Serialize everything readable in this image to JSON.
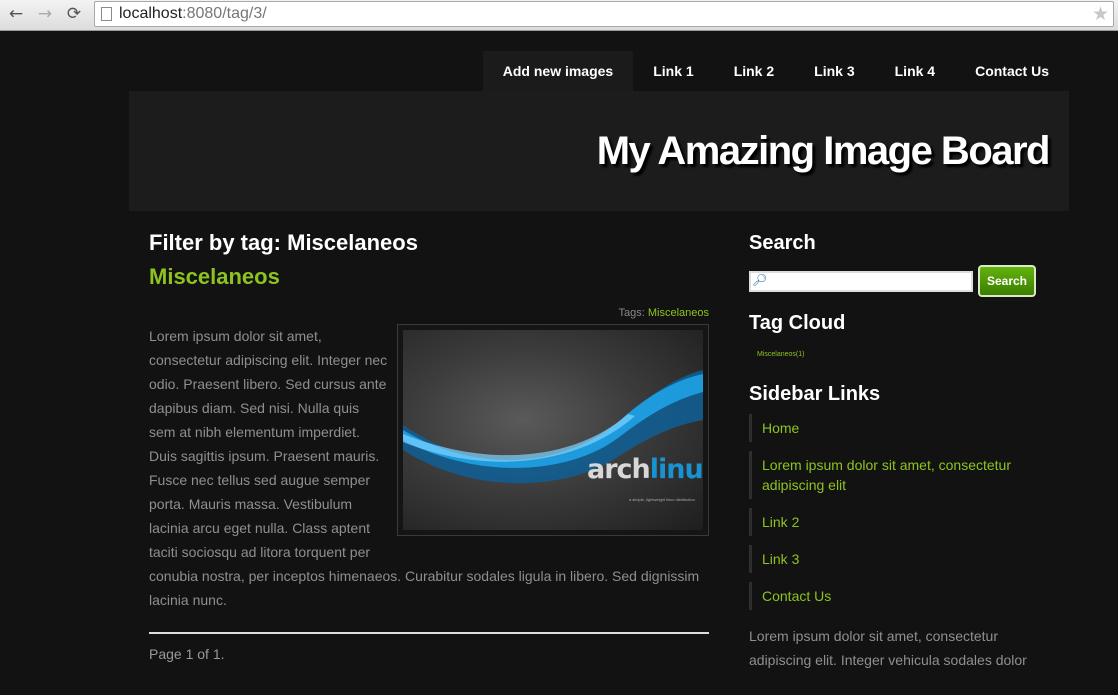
{
  "browser": {
    "url_host": "localhost",
    "url_rest": ":8080/tag/3/",
    "back_icon": "←",
    "forward_icon": "→",
    "reload_icon": "⟳",
    "star_icon": "★"
  },
  "nav": {
    "items": [
      "Add new images",
      "Link 1",
      "Link 2",
      "Link 3",
      "Link 4",
      "Contact Us"
    ],
    "active": "Add new images"
  },
  "header": {
    "title": "My Amazing Image Board"
  },
  "main": {
    "filter_title": "Filter by tag: Miscelaneos",
    "post_title": "Miscelaneos",
    "tags_label": "Tags:",
    "tag_link": "Miscelaneos",
    "body_text": "Lorem ipsum dolor sit amet, consectetur adipiscing elit. Integer nec odio. Praesent libero. Sed cursus ante dapibus diam. Sed nisi. Nulla quis sem at nibh elementum imperdiet. Duis sagittis ipsum. Praesent mauris. Fusce nec tellus sed augue semper porta. Mauris massa. Vestibulum lacinia arcu eget nulla. Class aptent taciti sociosqu ad litora torquent per conubia nostra, per inceptos himenaeos. Curabitur sodales ligula in libero. Sed dignissim lacinia nunc.",
    "image_logo_text_a": "arch",
    "image_logo_text_b": "linux",
    "image_logo_tagline": "a simple, lightweight linux distribution",
    "pager": "Page 1 of 1."
  },
  "sidebar": {
    "search_heading": "Search",
    "search_value": "",
    "search_button": "Search",
    "tag_cloud_heading": "Tag Cloud",
    "tag_cloud_item": "Miscelaneos(1)",
    "links_heading": "Sidebar Links",
    "links": [
      "Home",
      "Lorem ipsum dolor sit amet, consectetur adipiscing elit",
      "Link 2",
      "Link 3",
      "Contact Us"
    ],
    "text": "Lorem ipsum dolor sit amet, consectetur adipiscing elit. Integer vehicula sodales dolor"
  },
  "colors": {
    "accent": "#8dc31f",
    "background": "#121212",
    "header_bg": "#1c1c1c",
    "logo_blue": "#1793d1"
  }
}
